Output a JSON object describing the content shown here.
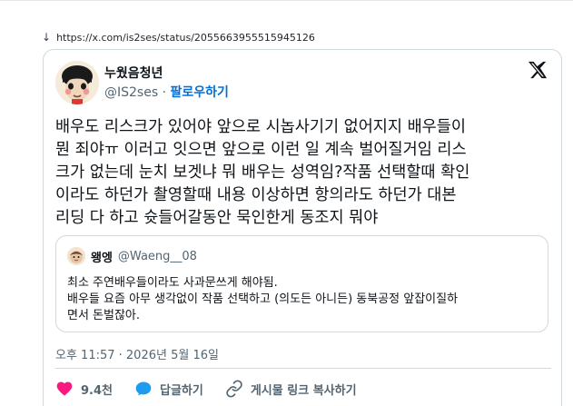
{
  "url_bar": {
    "arrow": "↓",
    "url": "https://x.com/is2ses/status/2055663955515945126"
  },
  "author": {
    "name": "누웠음청년",
    "handle": "@IS2ses",
    "separator": "·",
    "follow_label": "팔로우하기"
  },
  "tweet": {
    "text": "배우도 리스크가 있어야 앞으로 시놉사기기 없어지지 배우들이\n뭔 죄야ㅠ 이러고 잇으면 앞으로 이런 일 계속 벌어질거임 리스\n크가 없는데 눈치 보겟냐 뭐 배우는 성역임?작품 선택할때 확인\n이라도 하던가 촬영할때 내용 이상하면 항의라도 하던가 대본\n리딩 다 하고 슛들어갈동안 묵인한게 동조지 뭐야"
  },
  "quote": {
    "name": "왱엥",
    "handle": "@Waeng__08",
    "text": "최소 주연배우들이라도 사과문쓰게 해야됨.\n배우들 요즘 아무 생각없이 작품 선택하고 (의도든 아니든) 동북공정 앞잡이질하\n면서 돈벌잖아."
  },
  "timestamp": "오후 11:57 · 2026년 5월 16일",
  "actions": {
    "like_count": "9.4천",
    "reply_label": "답글하기",
    "copy_label": "게시물 링크 복사하기"
  },
  "colors": {
    "like": "#f91880",
    "reply": "#1d9bf0",
    "link": "#006fd6",
    "muted": "#536471",
    "border": "#cfd9de"
  },
  "icons": {
    "x_logo": "x-logo-icon",
    "like": "heart-icon",
    "reply": "speech-bubble-icon",
    "copy": "link-icon",
    "download": "download-arrow-icon"
  }
}
